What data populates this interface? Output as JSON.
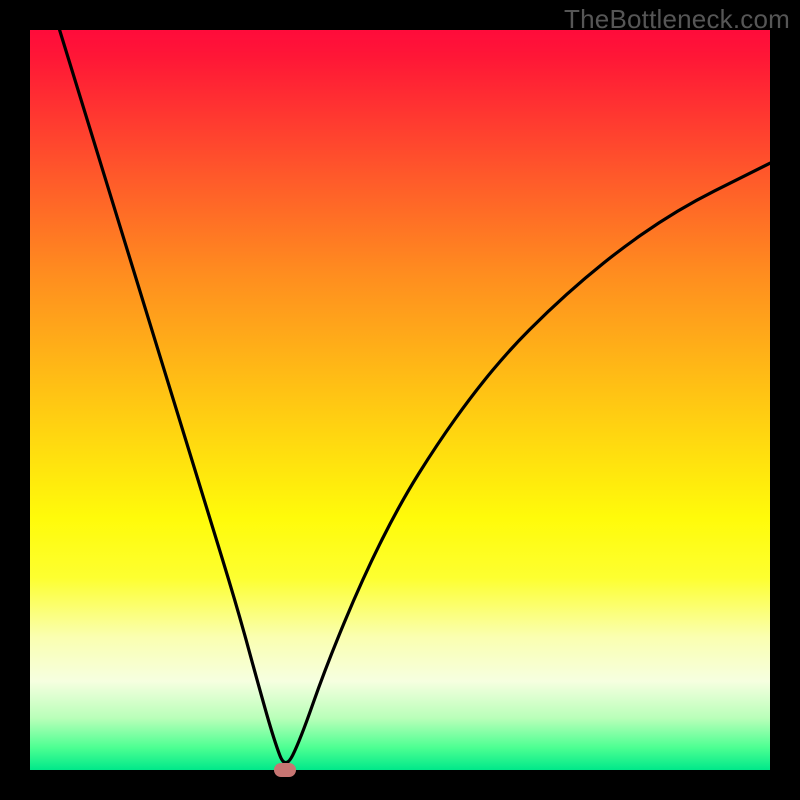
{
  "attribution": "TheBottleneck.com",
  "chart_data": {
    "type": "line",
    "title": "",
    "xlabel": "",
    "ylabel": "",
    "xlim": [
      0,
      100
    ],
    "ylim": [
      0,
      100
    ],
    "grid": false,
    "series": [
      {
        "name": "curve",
        "x": [
          4,
          8,
          12,
          16,
          20,
          24,
          28,
          31,
          33,
          34.5,
          36.5,
          40,
          45,
          50,
          55,
          60,
          65,
          70,
          75,
          80,
          85,
          90,
          95,
          100
        ],
        "values": [
          100,
          87,
          74,
          61,
          48,
          35,
          22,
          11,
          4,
          0,
          4,
          14,
          26,
          36,
          44,
          51,
          57,
          62,
          66.5,
          70.5,
          74,
          77,
          79.5,
          82
        ]
      }
    ],
    "marker": {
      "x": 34.5,
      "y": 0
    },
    "colors": {
      "curve": "#000000",
      "marker": "#c77572",
      "gradient_top": "#ff0b3b",
      "gradient_bottom": "#00e88a"
    }
  }
}
